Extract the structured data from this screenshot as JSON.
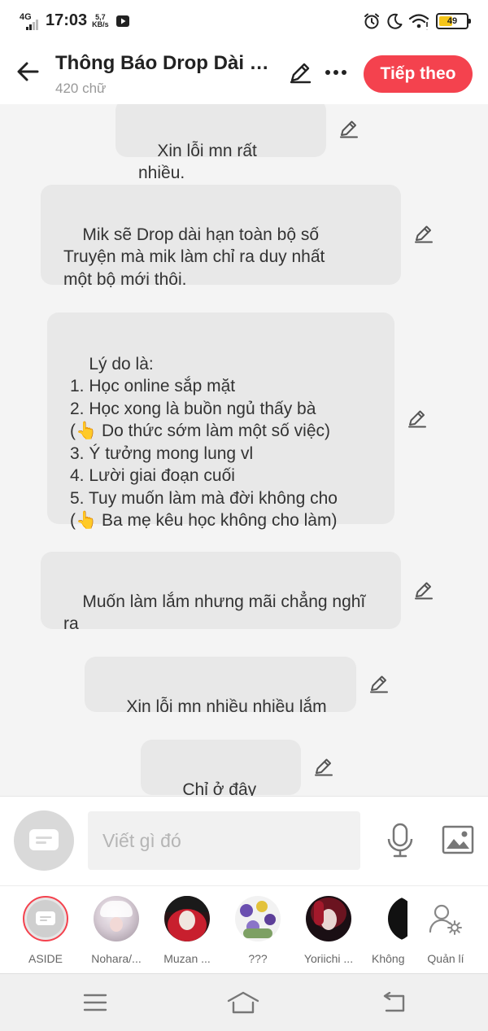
{
  "status_bar": {
    "network": "4G",
    "time": "17:03",
    "speed_value": "5,7",
    "speed_unit": "KB/s",
    "battery": "49",
    "battery_level": 0.49
  },
  "header": {
    "title": "Thông Báo Drop Dài Hạn",
    "word_count": "420 chữ",
    "next_label": "Tiếp theo"
  },
  "messages": [
    {
      "text": "Xin lỗi mn rất nhiều."
    },
    {
      "text": "Mik sẽ Drop dài hạn toàn bộ số\nTruyện mà mik làm chỉ ra duy nhất\nmột bộ mới thôi."
    },
    {
      "text": "Lý do là:\n1. Học online sắp mặt\n2. Học xong là buồn ngủ thấy bà\n(👆 Do thức sớm làm một số việc)\n3. Ý tưởng mong lung vl\n4. Lười giai đoạn cuối\n5. Tuy muốn làm mà đời không cho\n(👆 Ba mẹ kêu học không cho làm)"
    },
    {
      "text": "Muốn làm lắm nhưng mãi chẳng nghĩ\nra"
    },
    {
      "text": "Xin lỗi mn nhiều nhiều lắm"
    },
    {
      "text": "Chỉ ở đây thôi"
    }
  ],
  "composer": {
    "placeholder": "Viết gì đó"
  },
  "characters": [
    {
      "label": "ASIDE"
    },
    {
      "label": "Nohara/..."
    },
    {
      "label": "Muzan ..."
    },
    {
      "label": "???"
    },
    {
      "label": "Yoriichi ..."
    },
    {
      "label": "Không"
    },
    {
      "label": "Quản lí"
    }
  ],
  "colors": {
    "accent": "#f4424e",
    "bubble": "#e8e8e8",
    "background": "#f4f4f4"
  }
}
